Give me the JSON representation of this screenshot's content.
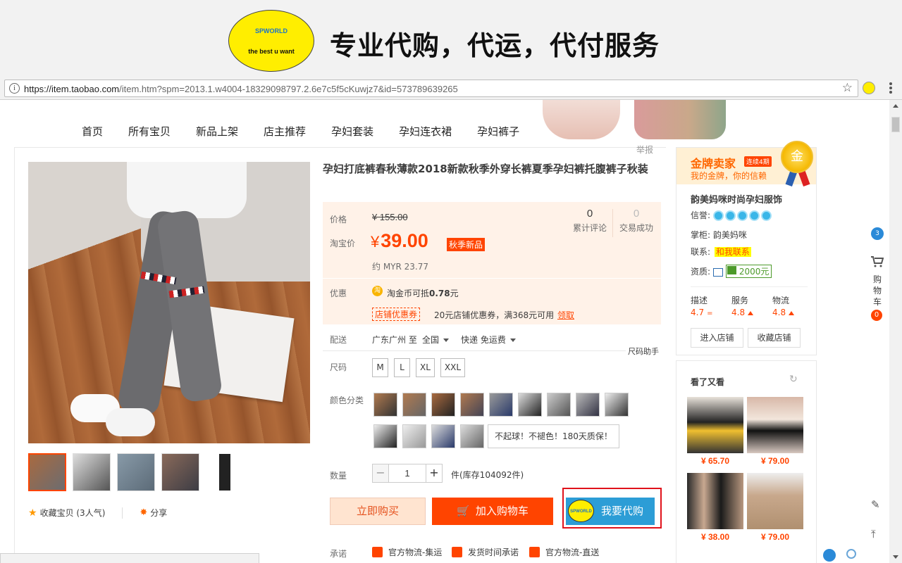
{
  "banner": {
    "badge_top": "SPWORLD",
    "badge_bottom": "the best u want",
    "title": "专业代购，代运，代付服务"
  },
  "browser": {
    "url_host": "https://item.taobao.com",
    "url_path": "/item.htm?spm=2013.1.w4004-18329098797.2.6e7c5f5cKuwjz7&id=573789639265"
  },
  "shop_nav": [
    "首页",
    "所有宝贝",
    "新品上架",
    "店主推荐",
    "孕妇套装",
    "孕妇连衣裙",
    "孕妇裤子"
  ],
  "report_label": "举报",
  "product": {
    "title": "孕妇打底裤春秋薄款2018新款秋季外穿长裤夏季孕妇裤托腹裤子秋装",
    "price_label": "价格",
    "original_price": "¥ 155.00",
    "taobao_price_label": "淘宝价",
    "currency": "¥",
    "price": "39.00",
    "new_tag": "秋季新品",
    "myr_price": "约 MYR 23.77",
    "reviews_count": "0",
    "reviews_label": "累计评论",
    "sales_count": "0",
    "sales_label": "交易成功",
    "promo_label": "优惠",
    "coin_icon": "淘",
    "coin_text_prefix": "淘金币可抵",
    "coin_amount": "0.78",
    "coin_text_suffix": "元",
    "coupon_tag": "店铺优惠券",
    "coupon_text": "20元店铺优惠券，满368元可用",
    "coupon_get": "领取",
    "shipping_label": "配送",
    "ship_from": "广东广州 至",
    "ship_to": "全国",
    "ship_fee": "快递 免运费",
    "size_help": "尺码助手",
    "size_label": "尺码",
    "sizes": [
      "M",
      "L",
      "XL",
      "XXL"
    ],
    "color_label": "颜色分类",
    "color_text_option": "不起球！不褪色！180天质保！",
    "qty_label": "数量",
    "qty_minus": "−",
    "qty_value": "1",
    "qty_plus": "+",
    "stock_text": "件(库存104092件)",
    "buy_now": "立即购买",
    "add_cart": "加入购物车",
    "proxy_logo": "SPWORLD",
    "proxy_buy": "我要代购",
    "promise_label": "承诺",
    "promises": [
      "官方物流-集运",
      "发货时间承诺",
      "官方物流-直送"
    ],
    "favorite_text": "收藏宝贝 (3人气)",
    "share_text": "分享"
  },
  "seller": {
    "gold_title": "金牌卖家",
    "gold_years": "连续4期",
    "gold_sub": "我的金牌，你的信赖",
    "medal_char": "金",
    "shop_name": "韵美妈咪时尚孕妇服饰",
    "credit_label": "信誉:",
    "keeper_label": "掌柜:",
    "keeper_name": "韵美妈咪",
    "contact_label": "联系:",
    "contact_tag": "和我联系",
    "qual_label": "资质:",
    "qual_amount": "2000元",
    "scores": [
      {
        "name": "描述",
        "value": "4.7",
        "trend": "="
      },
      {
        "name": "服务",
        "value": "4.8",
        "trend": "up"
      },
      {
        "name": "物流",
        "value": "4.8",
        "trend": "up"
      }
    ],
    "enter_shop": "进入店铺",
    "fav_shop": "收藏店铺"
  },
  "also_viewed": {
    "title": "看了又看",
    "items": [
      {
        "price": "¥ 65.70"
      },
      {
        "price": "¥ 79.00"
      },
      {
        "price": "¥ 38.00"
      },
      {
        "price": "¥ 79.00"
      }
    ]
  },
  "toolbar": {
    "cart_label": "购物车",
    "cart_count": "0",
    "bubble": "3"
  },
  "colors": {
    "accent": "#ff4400",
    "proxy_blue": "#2c9dd6",
    "highlight_red": "#e0121b"
  }
}
